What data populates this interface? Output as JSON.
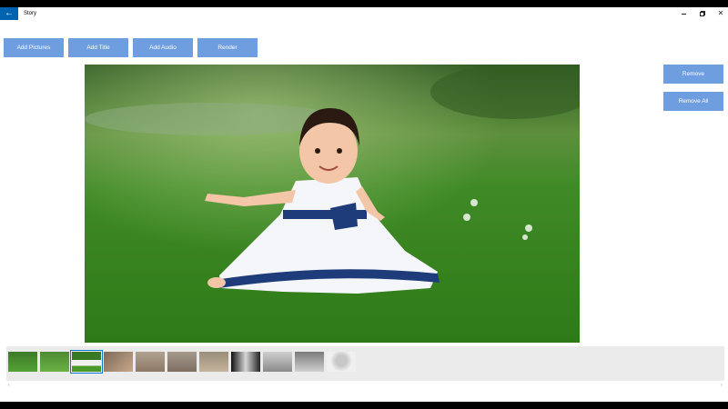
{
  "window": {
    "title": "Story",
    "back_glyph": "←",
    "close_glyph": "✕"
  },
  "toolbar": {
    "add_pictures": "Add Pictures",
    "add_title": "Add Title",
    "add_audio": "Add Audio",
    "render": "Render"
  },
  "side": {
    "remove": "Remove",
    "remove_all": "Remove All"
  },
  "filmstrip": {
    "thumbnail_count": 11,
    "selected_index": 2,
    "left_arrow": "‹",
    "right_arrow": "›"
  },
  "colors": {
    "accent": "#0063b1",
    "button": "#6f9ee0",
    "selected_outline": "#0078d7",
    "strip_bg": "#ebebeb"
  }
}
